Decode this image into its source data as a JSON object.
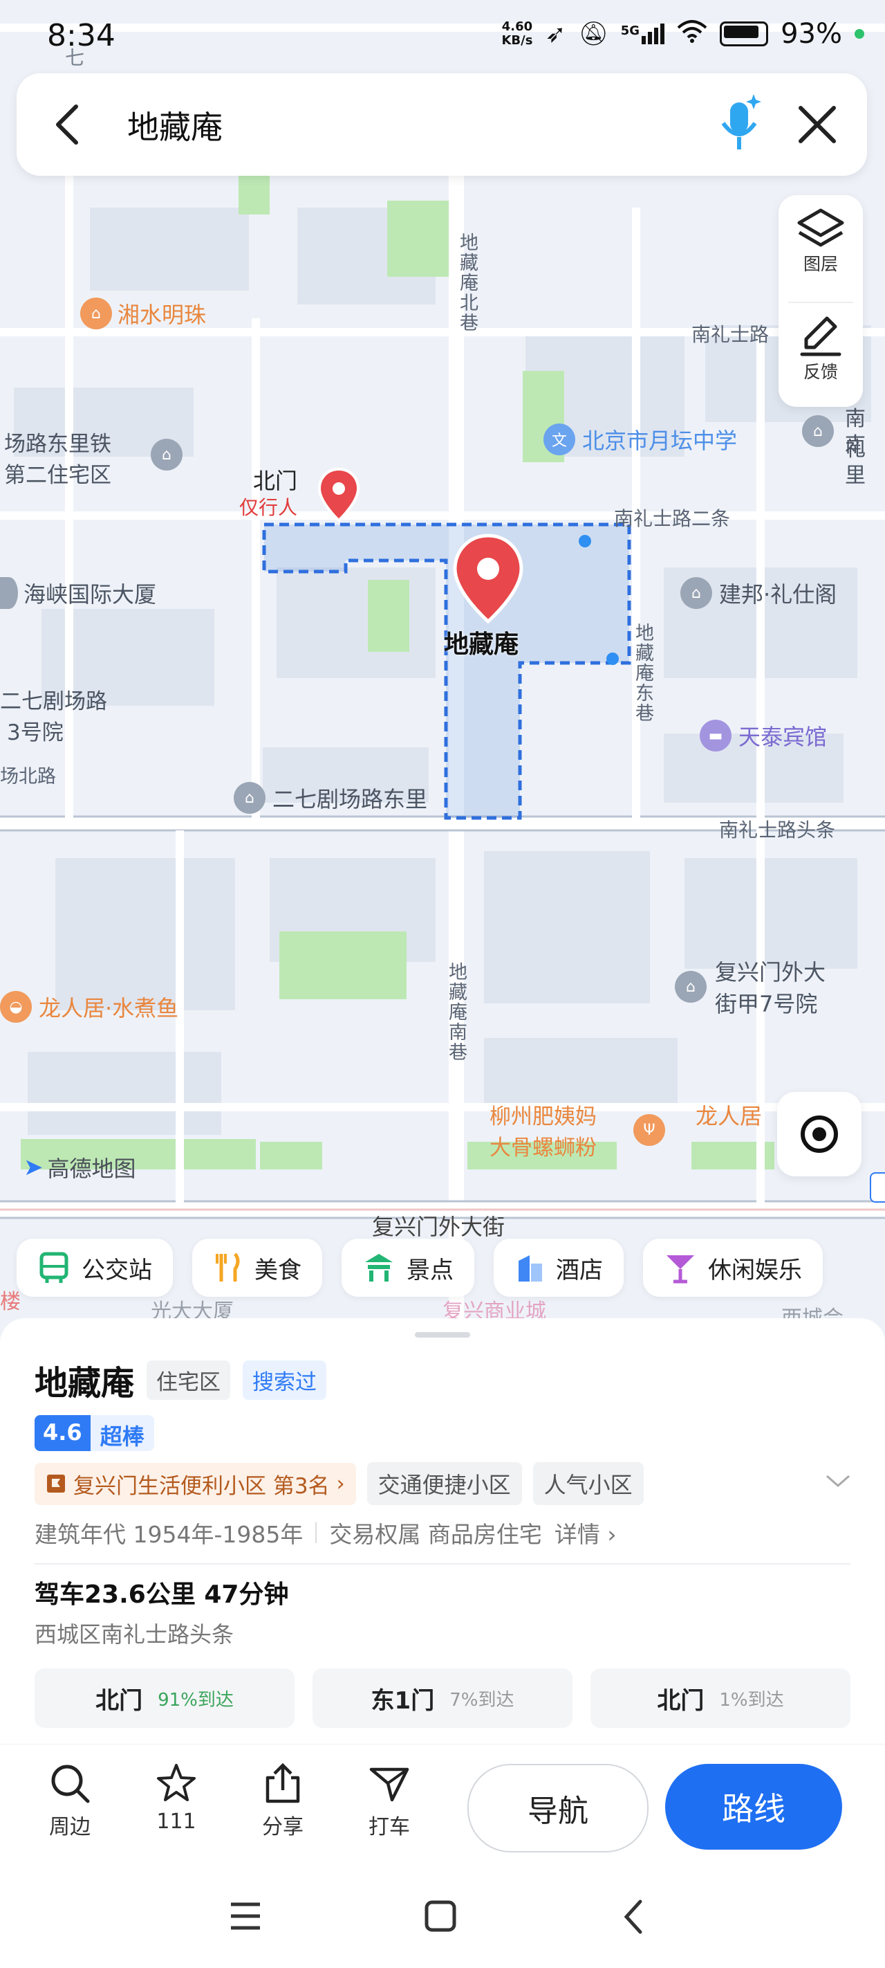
{
  "status_bar": {
    "time": "8:34",
    "net_speed_value": "4.60",
    "net_speed_unit": "KB/s",
    "signal": "5G",
    "battery": "93%"
  },
  "search": {
    "query": "地藏庵"
  },
  "map_tools": {
    "layers_label": "图层",
    "feedback_label": "反馈"
  },
  "map": {
    "labels": {
      "xiangshui": "湘水明珠",
      "nanlishi_road": "南礼士路",
      "changlu_dongli": "场路东里铁",
      "dier_zhuzhai": "第二住宅区",
      "yuetan_school": "北京市月坛中学",
      "nan_right1": "南礼",
      "nan_right2": "南里",
      "beimen": "北门",
      "pedestrian": "仅行人",
      "nanlishi_er": "南礼士路二条",
      "haixia": "海峡国际大厦",
      "jianbang": "建邦·礼仕阁",
      "dizang_center": "地藏庵",
      "erqi_left1": "二七剧场路",
      "erqi_left2": "3号院",
      "chang_beilu": "场北路",
      "tiantai": "天泰宾馆",
      "erqi_dongli": "二七剧场路东里",
      "nanlishi_toutiao": "南礼士路头条",
      "fuxingmen_a1": "复兴门外大",
      "fuxingmen_a2": "街甲7号院",
      "longrenju_left": "龙人居·水煮鱼",
      "liuzhou1": "柳州肥姨妈",
      "liuzhou2": "大骨螺蛳粉",
      "longrenju_right": "龙人居",
      "amap": "高德地图",
      "fuxingmen_street": "复兴门外大街",
      "guangda": "光大大厦",
      "fuxing_mall": "复兴商业城",
      "xicheng": "西城会",
      "left_lou": "楼",
      "left_qi": "七",
      "dizang_north": "地藏庵北巷",
      "dizang_east": "地藏庵东巷",
      "dizang_south": "地藏庵南巷"
    }
  },
  "chips": [
    {
      "label": "公交站",
      "icon": "bus-icon"
    },
    {
      "label": "美食",
      "icon": "food-icon"
    },
    {
      "label": "景点",
      "icon": "scenic-icon"
    },
    {
      "label": "酒店",
      "icon": "hotel-icon"
    },
    {
      "label": "休闲娱乐",
      "icon": "cocktail-icon"
    }
  ],
  "place": {
    "name": "地藏庵",
    "type_tag": "住宅区",
    "searched_tag": "搜索过",
    "rating": "4.6",
    "rating_text": "超棒",
    "rank_text": "复兴门生活便利小区 第3名",
    "tag_traffic": "交通便捷小区",
    "tag_popular": "人气小区",
    "build_years": "建筑年代 1954年-1985年",
    "ownership": "交易权属 商品房住宅",
    "details": "详情",
    "drive": "驾车23.6公里 47分钟",
    "address": "西城区南礼士路头条",
    "gates": [
      {
        "name": "北门",
        "percent": "91%到达"
      },
      {
        "name": "东1门",
        "percent": "7%到达"
      },
      {
        "name": "北门",
        "percent": "1%到达"
      }
    ]
  },
  "actions": {
    "nearby": "周边",
    "favorite_count": "111",
    "share": "分享",
    "taxi": "打车",
    "navigate": "导航",
    "route": "路线"
  },
  "colors": {
    "accent": "#1f6ff2",
    "pin": "#e8474b",
    "boundary": "#2f6fde"
  }
}
